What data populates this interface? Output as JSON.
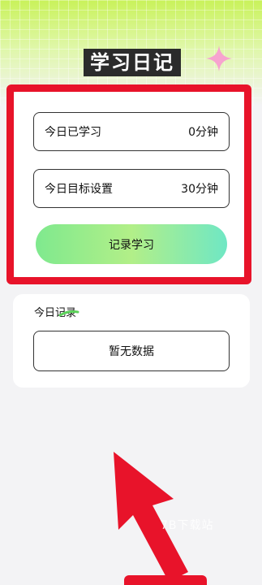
{
  "header": {
    "title": "学习日记"
  },
  "study": {
    "today_studied_label": "今日已学习",
    "today_studied_value": "0分钟",
    "goal_label": "今日目标设置",
    "goal_value": "30分钟",
    "record_button": "记录学习"
  },
  "records": {
    "section_label": "今日记录",
    "empty_text": "暂无数据"
  },
  "watermark": "7B下载站",
  "colors": {
    "highlight": "#e8132a",
    "button_gradient_start": "#7fe98e",
    "button_gradient_end": "#6fe7c4",
    "top_gradient": "#c9f25a"
  }
}
